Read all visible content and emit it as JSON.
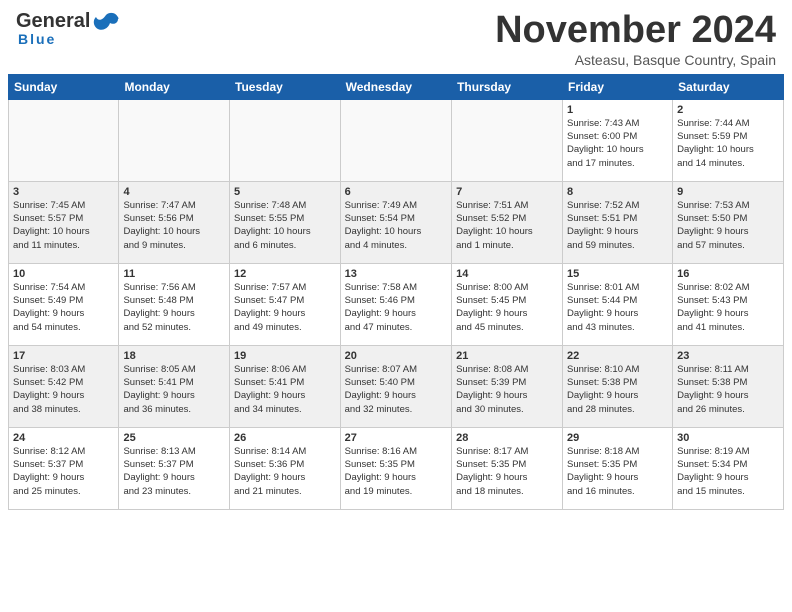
{
  "header": {
    "logo": {
      "general": "General",
      "blue": "Blue"
    },
    "title": "November 2024",
    "location": "Asteasu, Basque Country, Spain"
  },
  "calendar": {
    "weekdays": [
      "Sunday",
      "Monday",
      "Tuesday",
      "Wednesday",
      "Thursday",
      "Friday",
      "Saturday"
    ],
    "weeks": [
      [
        {
          "day": "",
          "info": ""
        },
        {
          "day": "",
          "info": ""
        },
        {
          "day": "",
          "info": ""
        },
        {
          "day": "",
          "info": ""
        },
        {
          "day": "",
          "info": ""
        },
        {
          "day": "1",
          "info": "Sunrise: 7:43 AM\nSunset: 6:00 PM\nDaylight: 10 hours\nand 17 minutes."
        },
        {
          "day": "2",
          "info": "Sunrise: 7:44 AM\nSunset: 5:59 PM\nDaylight: 10 hours\nand 14 minutes."
        }
      ],
      [
        {
          "day": "3",
          "info": "Sunrise: 7:45 AM\nSunset: 5:57 PM\nDaylight: 10 hours\nand 11 minutes."
        },
        {
          "day": "4",
          "info": "Sunrise: 7:47 AM\nSunset: 5:56 PM\nDaylight: 10 hours\nand 9 minutes."
        },
        {
          "day": "5",
          "info": "Sunrise: 7:48 AM\nSunset: 5:55 PM\nDaylight: 10 hours\nand 6 minutes."
        },
        {
          "day": "6",
          "info": "Sunrise: 7:49 AM\nSunset: 5:54 PM\nDaylight: 10 hours\nand 4 minutes."
        },
        {
          "day": "7",
          "info": "Sunrise: 7:51 AM\nSunset: 5:52 PM\nDaylight: 10 hours\nand 1 minute."
        },
        {
          "day": "8",
          "info": "Sunrise: 7:52 AM\nSunset: 5:51 PM\nDaylight: 9 hours\nand 59 minutes."
        },
        {
          "day": "9",
          "info": "Sunrise: 7:53 AM\nSunset: 5:50 PM\nDaylight: 9 hours\nand 57 minutes."
        }
      ],
      [
        {
          "day": "10",
          "info": "Sunrise: 7:54 AM\nSunset: 5:49 PM\nDaylight: 9 hours\nand 54 minutes."
        },
        {
          "day": "11",
          "info": "Sunrise: 7:56 AM\nSunset: 5:48 PM\nDaylight: 9 hours\nand 52 minutes."
        },
        {
          "day": "12",
          "info": "Sunrise: 7:57 AM\nSunset: 5:47 PM\nDaylight: 9 hours\nand 49 minutes."
        },
        {
          "day": "13",
          "info": "Sunrise: 7:58 AM\nSunset: 5:46 PM\nDaylight: 9 hours\nand 47 minutes."
        },
        {
          "day": "14",
          "info": "Sunrise: 8:00 AM\nSunset: 5:45 PM\nDaylight: 9 hours\nand 45 minutes."
        },
        {
          "day": "15",
          "info": "Sunrise: 8:01 AM\nSunset: 5:44 PM\nDaylight: 9 hours\nand 43 minutes."
        },
        {
          "day": "16",
          "info": "Sunrise: 8:02 AM\nSunset: 5:43 PM\nDaylight: 9 hours\nand 41 minutes."
        }
      ],
      [
        {
          "day": "17",
          "info": "Sunrise: 8:03 AM\nSunset: 5:42 PM\nDaylight: 9 hours\nand 38 minutes."
        },
        {
          "day": "18",
          "info": "Sunrise: 8:05 AM\nSunset: 5:41 PM\nDaylight: 9 hours\nand 36 minutes."
        },
        {
          "day": "19",
          "info": "Sunrise: 8:06 AM\nSunset: 5:41 PM\nDaylight: 9 hours\nand 34 minutes."
        },
        {
          "day": "20",
          "info": "Sunrise: 8:07 AM\nSunset: 5:40 PM\nDaylight: 9 hours\nand 32 minutes."
        },
        {
          "day": "21",
          "info": "Sunrise: 8:08 AM\nSunset: 5:39 PM\nDaylight: 9 hours\nand 30 minutes."
        },
        {
          "day": "22",
          "info": "Sunrise: 8:10 AM\nSunset: 5:38 PM\nDaylight: 9 hours\nand 28 minutes."
        },
        {
          "day": "23",
          "info": "Sunrise: 8:11 AM\nSunset: 5:38 PM\nDaylight: 9 hours\nand 26 minutes."
        }
      ],
      [
        {
          "day": "24",
          "info": "Sunrise: 8:12 AM\nSunset: 5:37 PM\nDaylight: 9 hours\nand 25 minutes."
        },
        {
          "day": "25",
          "info": "Sunrise: 8:13 AM\nSunset: 5:37 PM\nDaylight: 9 hours\nand 23 minutes."
        },
        {
          "day": "26",
          "info": "Sunrise: 8:14 AM\nSunset: 5:36 PM\nDaylight: 9 hours\nand 21 minutes."
        },
        {
          "day": "27",
          "info": "Sunrise: 8:16 AM\nSunset: 5:35 PM\nDaylight: 9 hours\nand 19 minutes."
        },
        {
          "day": "28",
          "info": "Sunrise: 8:17 AM\nSunset: 5:35 PM\nDaylight: 9 hours\nand 18 minutes."
        },
        {
          "day": "29",
          "info": "Sunrise: 8:18 AM\nSunset: 5:35 PM\nDaylight: 9 hours\nand 16 minutes."
        },
        {
          "day": "30",
          "info": "Sunrise: 8:19 AM\nSunset: 5:34 PM\nDaylight: 9 hours\nand 15 minutes."
        }
      ]
    ]
  }
}
